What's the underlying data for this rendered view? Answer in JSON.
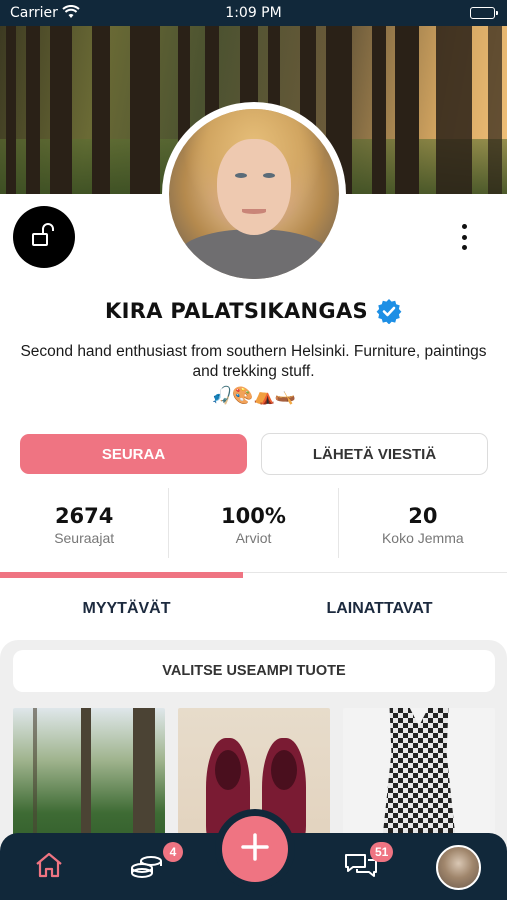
{
  "status_bar": {
    "carrier": "Carrier",
    "time": "1:09 PM"
  },
  "profile": {
    "name": "KIRA PALATSIKANGAS",
    "verified": true,
    "bio": "Second hand enthusiast from southern Helsinki. Furniture, paintings and trekking stuff.",
    "emojis": "🎣🎨⛺🛶"
  },
  "actions": {
    "follow_label": "SEURAA",
    "message_label": "LÄHETÄ VIESTIÄ"
  },
  "stats": [
    {
      "value": "2674",
      "label": "Seuraajat"
    },
    {
      "value": "100%",
      "label": "Arviot"
    },
    {
      "value": "20",
      "label": "Koko Jemma"
    }
  ],
  "tabs": [
    {
      "label": "MYYTÄVÄT",
      "active": true
    },
    {
      "label": "LAINATTAVAT",
      "active": false
    }
  ],
  "products": {
    "select_multiple_label": "VALITSE USEAMPI TUOTE"
  },
  "tab_bar": {
    "coins_badge": "4",
    "messages_badge": "51",
    "icons": [
      "home-icon",
      "coins-icon",
      "add-icon",
      "chat-icon",
      "profile-avatar"
    ]
  },
  "colors": {
    "accent": "#ef7482",
    "navy": "#11283a",
    "verified": "#1d8fe5"
  }
}
